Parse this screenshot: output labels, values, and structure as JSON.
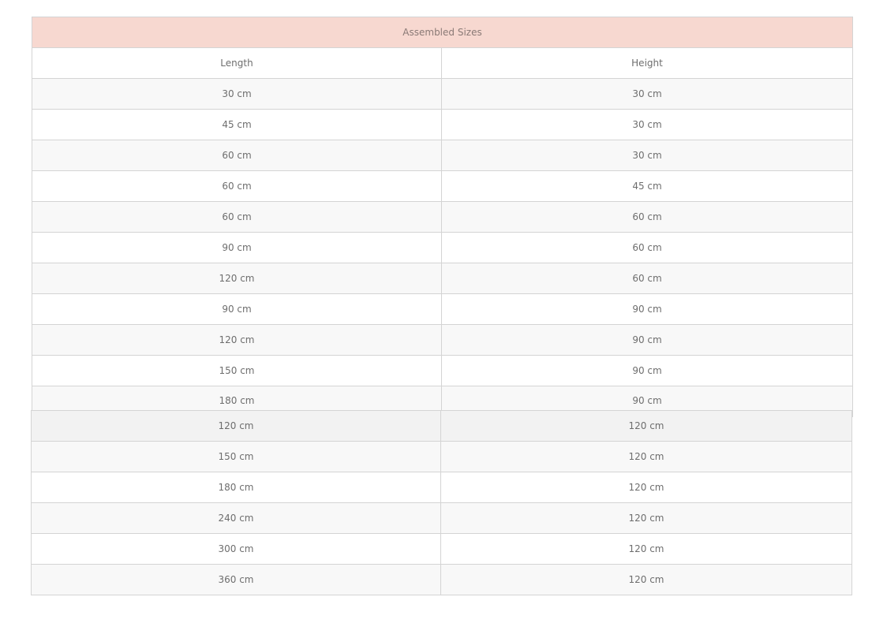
{
  "table": {
    "title": "Assembled Sizes",
    "headers": [
      "Length",
      "Height"
    ],
    "rows_top": [
      [
        "30 cm",
        "30 cm"
      ],
      [
        "45 cm",
        "30 cm"
      ],
      [
        "60 cm",
        "30 cm"
      ],
      [
        "60 cm",
        "45 cm"
      ],
      [
        "60 cm",
        "60 cm"
      ],
      [
        "90 cm",
        "60 cm"
      ],
      [
        "120 cm",
        "60 cm"
      ],
      [
        "90 cm",
        "90 cm"
      ],
      [
        "120 cm",
        "90 cm"
      ],
      [
        "150 cm",
        "90 cm"
      ],
      [
        "180 cm",
        "90 cm"
      ]
    ],
    "rows_bottom": [
      [
        "120 cm",
        "120 cm"
      ],
      [
        "150 cm",
        "120 cm"
      ],
      [
        "180 cm",
        "120 cm"
      ],
      [
        "240 cm",
        "120 cm"
      ],
      [
        "300 cm",
        "120 cm"
      ],
      [
        "360 cm",
        "120 cm"
      ]
    ]
  }
}
